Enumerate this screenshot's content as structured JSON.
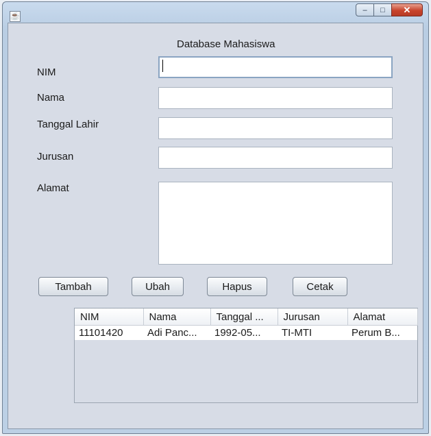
{
  "window": {
    "minimize_symbol": "–",
    "maximize_symbol": "□",
    "close_symbol": "✕",
    "app_icon": "java-cup-icon"
  },
  "form": {
    "title": "Database Mahasiswa",
    "labels": {
      "nim": "NIM",
      "nama": "Nama",
      "tanggal_lahir": "Tanggal Lahir",
      "jurusan": "Jurusan",
      "alamat": "Alamat"
    },
    "values": {
      "nim": "",
      "nama": "",
      "tanggal_lahir": "",
      "jurusan": "",
      "alamat": ""
    }
  },
  "buttons": {
    "tambah": "Tambah",
    "ubah": "Ubah",
    "hapus": "Hapus",
    "cetak": "Cetak"
  },
  "table": {
    "headers": [
      "NIM",
      "Nama",
      "Tanggal ...",
      "Jurusan",
      "Alamat"
    ],
    "rows": [
      [
        "11101420",
        "Adi Panc...",
        "1992-05...",
        "TI-MTI",
        "Perum B..."
      ]
    ]
  }
}
